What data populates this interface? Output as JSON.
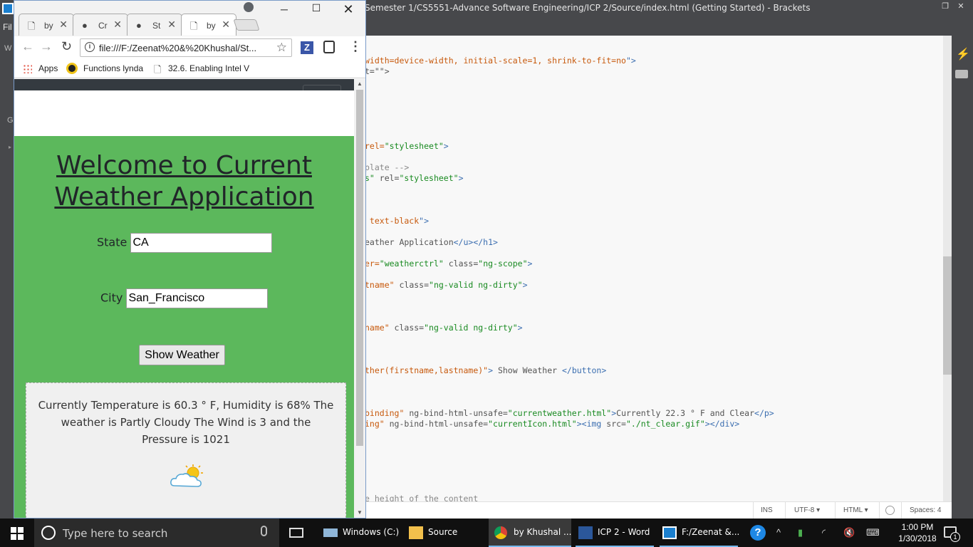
{
  "brackets": {
    "title": "Semester 1/CS5551-Advance Software Engineering/ICP 2/Source/index.html (Getting Started) - Brackets",
    "menu_file": "Fil",
    "side_w": "W",
    "side_g": "G",
    "code_lines": [
      {
        "parts": [
          [
            "attr",
            "width=device-width, initial-scale=1, shrink-to-fit=no"
          ],
          [
            "tag",
            "\">"
          ]
        ]
      },
      {
        "parts": [
          [
            "plain",
            "t=\"\">"
          ]
        ]
      },
      {
        "parts": [
          [
            "attr",
            "rel="
          ],
          [
            "str",
            "\"stylesheet\""
          ],
          [
            "tag",
            ">"
          ]
        ]
      },
      {
        "parts": [
          [
            "cmt",
            "plate -->"
          ]
        ]
      },
      {
        "parts": [
          [
            "str",
            "s\""
          ],
          [
            "plain",
            " rel="
          ],
          [
            "str",
            "\"stylesheet\""
          ],
          [
            "tag",
            ">"
          ]
        ]
      },
      {
        "parts": [
          [
            "attr",
            " text-black"
          ],
          [
            "tag",
            "\">"
          ]
        ]
      },
      {
        "parts": [
          [
            "plain",
            "eather Application"
          ],
          [
            "tag",
            "</u></h1>"
          ]
        ]
      },
      {
        "parts": [
          [
            "attr",
            "er="
          ],
          [
            "str",
            "\"weatherctrl\""
          ],
          [
            "plain",
            " class="
          ],
          [
            "str",
            "\"ng-scope\""
          ],
          [
            "tag",
            ">"
          ]
        ]
      },
      {
        "parts": [
          [
            "attr",
            "tname\""
          ],
          [
            "plain",
            " class="
          ],
          [
            "str",
            "\"ng-valid ng-dirty\""
          ],
          [
            "tag",
            ">"
          ]
        ]
      },
      {
        "parts": [
          [
            "attr",
            "name\""
          ],
          [
            "plain",
            " class="
          ],
          [
            "str",
            "\"ng-valid ng-dirty\""
          ],
          [
            "tag",
            ">"
          ]
        ]
      },
      {
        "parts": [
          [
            "attr",
            "ther(firstname,lastname)\""
          ],
          [
            "tag",
            ">"
          ],
          [
            "plain",
            " Show Weather "
          ],
          [
            "tag",
            "</button>"
          ]
        ]
      },
      {
        "parts": [
          [
            "attr",
            "binding\""
          ],
          [
            "plain",
            " ng-bind-html-unsafe="
          ],
          [
            "str",
            "\"currentweather.html\""
          ],
          [
            "tag",
            ">"
          ],
          [
            "plain",
            "Currently 22.3 ° F and Clear"
          ],
          [
            "tag",
            "</p>"
          ]
        ]
      },
      {
        "parts": [
          [
            "attr",
            "ing\""
          ],
          [
            "plain",
            " ng-bind-html-unsafe="
          ],
          [
            "str",
            "\"currentIcon.html\""
          ],
          [
            "tag",
            "><img"
          ],
          [
            "plain",
            " src="
          ],
          [
            "str",
            "\"./nt_clear.gif\""
          ],
          [
            "tag",
            "></div>"
          ]
        ]
      },
      {
        "parts": [
          [
            "cmt",
            "e height of the content"
          ]
        ]
      }
    ],
    "status": {
      "ins": "INS",
      "encoding": "UTF-8 ▾",
      "language": "HTML ▾",
      "spaces": "Spaces: 4"
    }
  },
  "chrome": {
    "tabs": [
      {
        "title": "by",
        "icon": "page-icon"
      },
      {
        "title": "Cr",
        "icon": "github-icon"
      },
      {
        "title": "St",
        "icon": "github-icon"
      },
      {
        "title": "by",
        "icon": "page-icon"
      }
    ],
    "url": "file:///F:/Zeenat%20&%20Khushal/St...",
    "bookmarks": {
      "apps": "Apps",
      "lynda": "Functions lynda",
      "intel": "32.6. Enabling Intel V"
    }
  },
  "page": {
    "title": "Welcome to Current Weather Application",
    "state_label": "State",
    "state_value": "CA",
    "city_label": "City",
    "city_value": "San_Francisco",
    "button_label": "Show Weather",
    "result_text": "Currently Temperature is 60.3 ° F, Humidity is 68% The weather is Partly Cloudy The Wind is 3 and the Pressure is 1021",
    "weather_icon": "partly-cloudy-icon"
  },
  "taskbar": {
    "search_placeholder": "Type here to search",
    "apps": [
      {
        "label": "Windows (C:)",
        "icon": "drive-icon"
      },
      {
        "label": "Source",
        "icon": "folder-icon"
      },
      {
        "label": "by Khushal ...",
        "icon": "chrome-icon"
      },
      {
        "label": "ICP 2 - Word",
        "icon": "word-icon"
      },
      {
        "label": "F:/Zeenat &...",
        "icon": "brackets-icon"
      }
    ],
    "time": "1:00 PM",
    "date": "1/30/2018",
    "notifications": "1"
  },
  "colors": {
    "page_green": "#5cb85c",
    "navbar_dark": "#343a40",
    "taskbar": "#101010",
    "accent": "#76b9ed"
  }
}
